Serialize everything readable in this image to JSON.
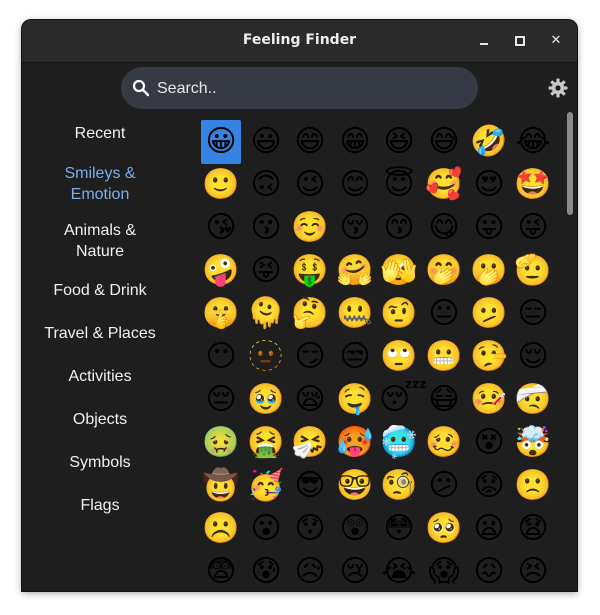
{
  "window": {
    "title": "Feeling Finder"
  },
  "search": {
    "placeholder": "Search.."
  },
  "sidebar": {
    "items": [
      {
        "label": "Recent"
      },
      {
        "label": "Smileys & Emotion",
        "active": true
      },
      {
        "label": "Animals & Nature"
      },
      {
        "label": "Food & Drink"
      },
      {
        "label": "Travel & Places"
      },
      {
        "label": "Activities"
      },
      {
        "label": "Objects"
      },
      {
        "label": "Symbols"
      },
      {
        "label": "Flags"
      }
    ]
  },
  "emoji_grid": {
    "selected_index": 0,
    "rows": [
      [
        "😀",
        "😃",
        "😄",
        "😁",
        "😆",
        "😅",
        "🤣",
        "😂"
      ],
      [
        "🙂",
        "🙃",
        "😉",
        "😊",
        "😇",
        "🥰",
        "😍",
        "🤩"
      ],
      [
        "😘",
        "😗",
        "☺️",
        "😚",
        "😙",
        "😋",
        "😛",
        "😜"
      ],
      [
        "🤪",
        "😝",
        "🤑",
        "🤗",
        "🫣",
        "🤭",
        "🫢",
        "🫡"
      ],
      [
        "🤫",
        "🫠",
        "🤔",
        "🤐",
        "🤨",
        "😐",
        "🫤",
        "😑"
      ],
      [
        "😶",
        "🫥",
        "😏",
        "😒",
        "🙄",
        "😬",
        "🤥",
        "😌"
      ],
      [
        "😔",
        "🥹",
        "😪",
        "🤤",
        "😴",
        "😷",
        "🤒",
        "🤕"
      ],
      [
        "🤢",
        "🤮",
        "🤧",
        "🥵",
        "🥶",
        "🥴",
        "😵",
        "🤯"
      ],
      [
        "🤠",
        "🥳",
        "😎",
        "🤓",
        "🧐",
        "😕",
        "😟",
        "🙁"
      ],
      [
        "☹️",
        "😮",
        "😯",
        "😲",
        "😳",
        "🥺",
        "😦",
        "😧"
      ],
      [
        "😨",
        "😰",
        "😥",
        "😢",
        "😭",
        "😱",
        "😖",
        "😣"
      ]
    ]
  },
  "colors": {
    "accent": "#3584e4",
    "active_text": "#78aeed",
    "background": "#1e1e1e"
  },
  "icons": {
    "search": "search-icon",
    "settings": "gear-icon"
  }
}
